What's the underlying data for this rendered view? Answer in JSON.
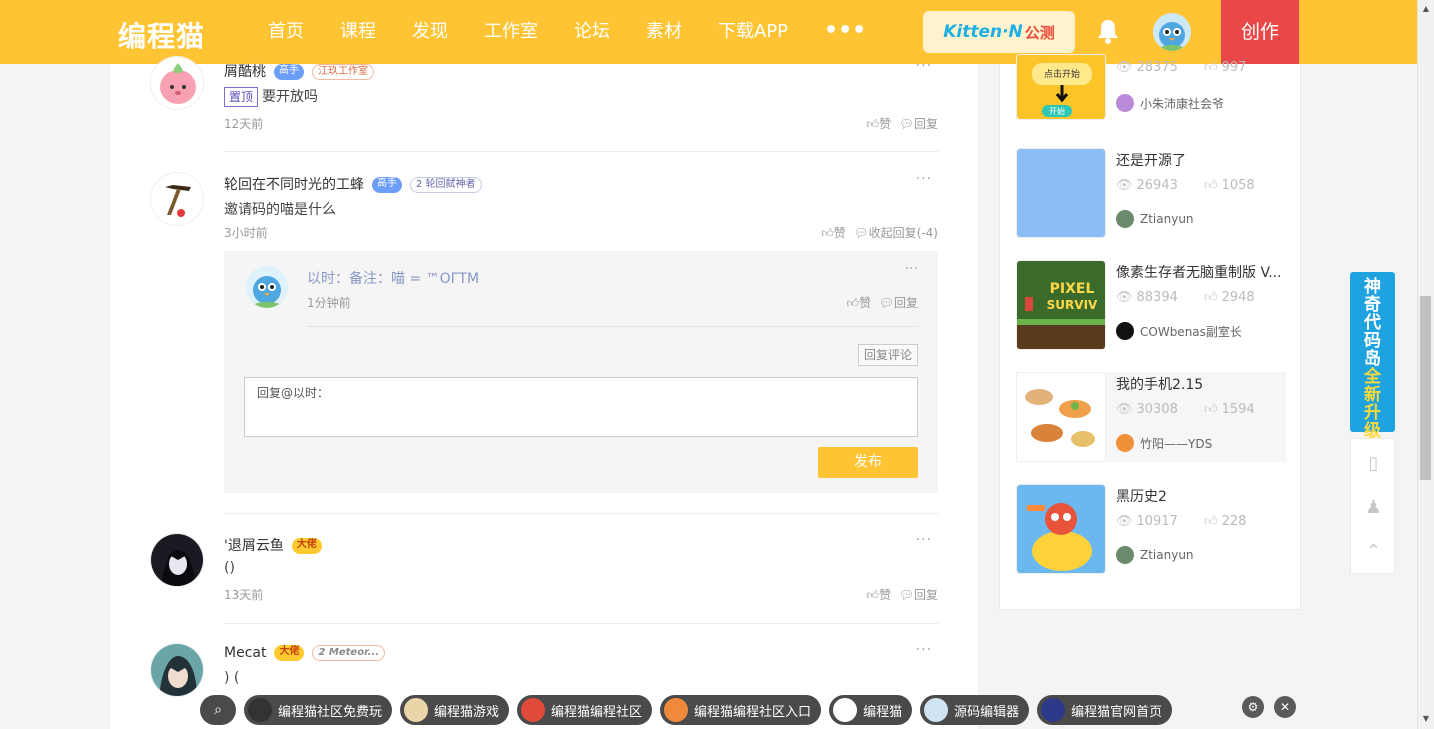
{
  "header": {
    "logo": "编程猫",
    "nav": [
      "首页",
      "课程",
      "发现",
      "工作室",
      "论坛",
      "素材",
      "下载APP"
    ],
    "more": "•••",
    "kitten_label": "Kitten·N",
    "kitten_tag": "公测",
    "create": "创作",
    "colors": {
      "brand": "#fec433",
      "create": "#ea4848"
    }
  },
  "comments": [
    {
      "name": "屑酷桃",
      "badges": [
        "高手",
        "江玖工作室"
      ],
      "pin": "置顶",
      "text": "要开放吗",
      "time": "12天前",
      "actions": [
        "赞",
        "回复"
      ]
    },
    {
      "name": "轮回在不同时光的工蜂",
      "badges": [
        "高手",
        "轮回弑神者"
      ],
      "badge_num": "2",
      "text": "邀请码的喵是什么",
      "time": "3小时前",
      "actions": [
        "赞",
        "收起回复(-4)"
      ],
      "reply": {
        "text": "以时：备注：喵 = ™OΓTM",
        "time": "1分钟前",
        "actions": [
          "赞",
          "回复"
        ]
      },
      "reply_comment_btn": "回复评论",
      "input_value": "回复@以时：",
      "publish": "发布"
    },
    {
      "name": "'退屑云鱼",
      "badges": [
        "大佬"
      ],
      "text": "()",
      "time": "13天前",
      "actions": [
        "赞",
        "回复"
      ]
    },
    {
      "name": "Mecat",
      "badges": [
        "大佬",
        "Meteor..."
      ],
      "badge_num": "2",
      "text": ")  (",
      "time": "",
      "actions": []
    }
  ],
  "works": [
    {
      "title": "",
      "views": "28375",
      "likes": "997",
      "author": "小朱沛康社会爷",
      "thumb_text": "点击开始",
      "thumb_btn": "开始"
    },
    {
      "title": "还是开源了",
      "views": "26943",
      "likes": "1058",
      "author": "Ztianyun"
    },
    {
      "title": "像素生存者无脑重制版 V...",
      "views": "88394",
      "likes": "2948",
      "author": "COWbenas副室长",
      "thumb_text": "PIXEL SURVIV"
    },
    {
      "title": "我的手机2.15",
      "views": "30308",
      "likes": "1594",
      "author": "竹阳——YDS"
    },
    {
      "title": "黑历史2",
      "views": "10917",
      "likes": "228",
      "author": "Ztianyun"
    }
  ],
  "promo": [
    "神",
    "奇",
    "代",
    "码",
    "岛",
    "全",
    "新",
    "升",
    "级"
  ],
  "bottom_links": [
    "编程猫社区免费玩",
    "编程猫游戏",
    "编程猫编程社区",
    "编程猫编程社区入口",
    "编程猫",
    "源码编辑器",
    "编程猫官网首页"
  ]
}
